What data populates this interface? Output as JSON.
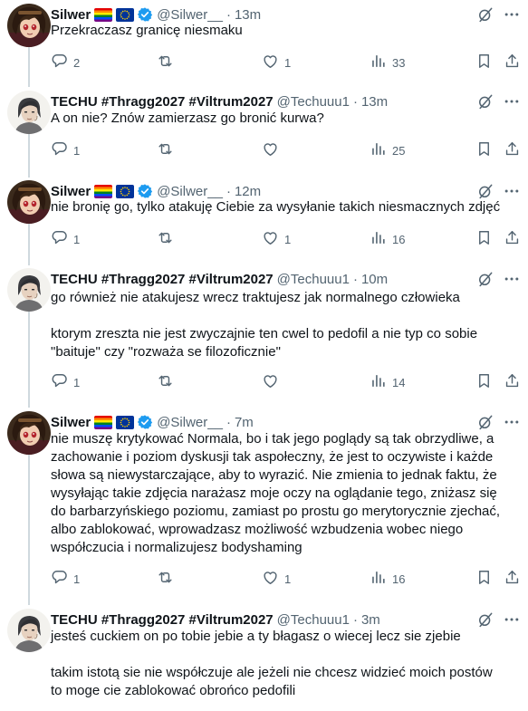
{
  "colors": {
    "text": "#0f1419",
    "muted": "#536471",
    "verified": "#1d9bf0",
    "thread_line": "#cfd9de"
  },
  "icons": {
    "reply": "reply-icon",
    "repost": "repost-icon",
    "like": "heart-icon",
    "views": "views-icon",
    "bookmark": "bookmark-icon",
    "share": "share-icon",
    "verified": "verified-badge-icon",
    "more": "more-icon",
    "grok": "grok-icon"
  },
  "tweets": [
    {
      "name": "Silwer",
      "handle": "@Silwer__",
      "sep": "·",
      "time": "13m",
      "author": "silwer",
      "lines": [
        "Przekraczasz granicę niesmaku"
      ],
      "replies": "2",
      "reposts": "",
      "likes": "1",
      "views": "33"
    },
    {
      "name": "TECHU #Thragg2027 #Viltrum2027",
      "handle": "@Techuuu1",
      "sep": "·",
      "time": "13m",
      "author": "techu",
      "lines": [
        "A on nie? Znów zamierzasz go bronić kurwa?"
      ],
      "replies": "1",
      "reposts": "",
      "likes": "",
      "views": "25"
    },
    {
      "name": "Silwer",
      "handle": "@Silwer__",
      "sep": "·",
      "time": "12m",
      "author": "silwer",
      "lines": [
        "nie bronię go, tylko atakuję Ciebie za wysyłanie takich niesmacznych zdjęć"
      ],
      "replies": "1",
      "reposts": "",
      "likes": "1",
      "views": "16"
    },
    {
      "name": "TECHU #Thragg2027 #Viltrum2027",
      "handle": "@Techuuu1",
      "sep": "·",
      "time": "10m",
      "author": "techu",
      "lines": [
        "go również nie atakujesz wrecz traktujesz jak normalnego człowieka",
        "",
        "ktorym zreszta nie jest zwyczajnie ten cwel to pedofil a nie typ co sobie",
        "\"baituje\" czy \"rozważa se filozoficznie\""
      ],
      "replies": "1",
      "reposts": "",
      "likes": "",
      "views": "14"
    },
    {
      "name": "Silwer",
      "handle": "@Silwer__",
      "sep": "·",
      "time": "7m",
      "author": "silwer",
      "lines": [
        "nie muszę krytykować Normala, bo i tak jego poglądy są tak obrzydliwe, a",
        "zachowanie i poziom dyskusji tak aspołeczny, że jest to oczywiste i każde",
        "słowa są niewystarczające, aby to wyrazić. Nie zmienia to jednak faktu, że",
        "wysyłając takie zdjęcia narażasz moje oczy na oglądanie tego, zniżasz się",
        "do barbarzyńskiego poziomu, zamiast po prostu go merytorycznie zjechać,",
        "albo zablokować, wprowadzasz możliwość wzbudzenia wobec niego",
        "współczucia i normalizujesz bodyshaming"
      ],
      "replies": "1",
      "reposts": "",
      "likes": "1",
      "views": "16"
    },
    {
      "name": "TECHU #Thragg2027 #Viltrum2027",
      "handle": "@Techuuu1",
      "sep": "·",
      "time": "3m",
      "author": "techu",
      "lines": [
        "jesteś cuckiem on po tobie jebie a ty błagasz o wiecej lecz sie zjebie",
        "",
        "takim istotą sie nie współczuje ale jeżeli nie chcesz widzieć moich postów",
        "to moge cie zablokować obrońco pedofili"
      ]
    }
  ]
}
